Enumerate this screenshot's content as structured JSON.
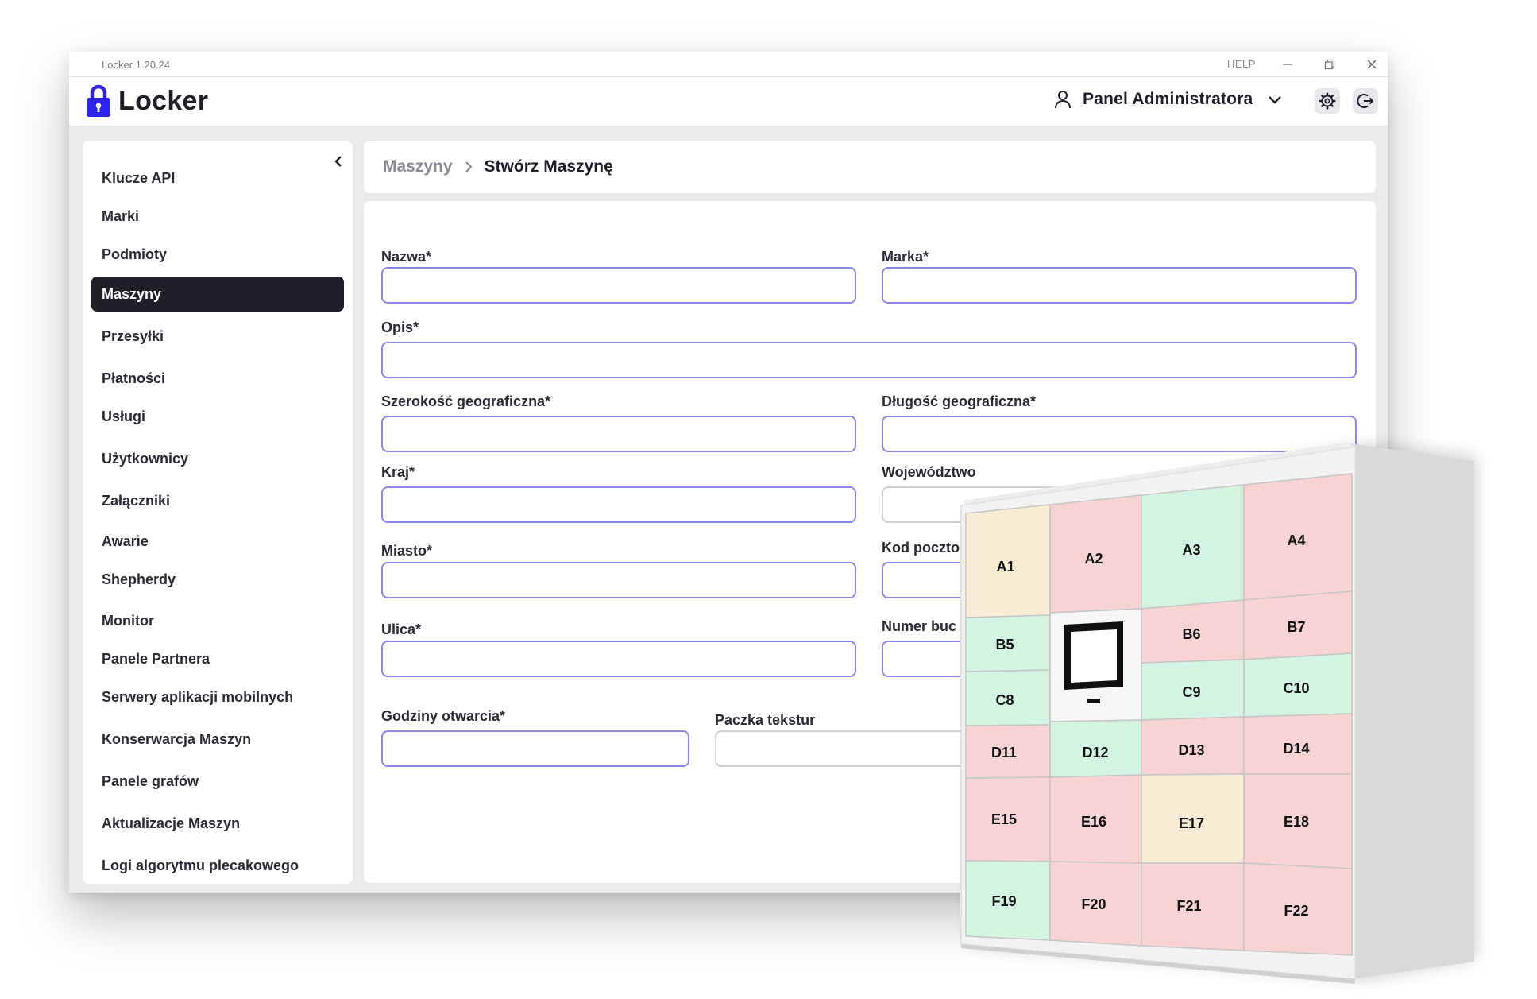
{
  "window": {
    "title": "Locker 1.20.24",
    "help": "HELP"
  },
  "app": {
    "name": "Locker",
    "user_label": "Panel Administratora"
  },
  "sidebar": {
    "items": [
      {
        "label": "Klucze API",
        "active": false
      },
      {
        "label": "Marki",
        "active": false
      },
      {
        "label": "Podmioty",
        "active": false
      },
      {
        "label": "Maszyny",
        "active": true
      },
      {
        "label": "Przesyłki",
        "active": false
      },
      {
        "label": "Płatności",
        "active": false
      },
      {
        "label": "Usługi",
        "active": false
      },
      {
        "label": "Użytkownicy",
        "active": false
      },
      {
        "label": "Załączniki",
        "active": false
      },
      {
        "label": "Awarie",
        "active": false
      },
      {
        "label": "Shepherdy",
        "active": false
      },
      {
        "label": "Monitor",
        "active": false
      },
      {
        "label": "Panele Partnera",
        "active": false
      },
      {
        "label": "Serwery aplikacji mobilnych",
        "active": false
      },
      {
        "label": "Konserwarcja Maszyn",
        "active": false
      },
      {
        "label": "Panele grafów",
        "active": false
      },
      {
        "label": "Aktualizacje Maszyn",
        "active": false
      },
      {
        "label": "Logi algorytmu plecakowego",
        "active": false
      }
    ]
  },
  "breadcrumb": {
    "parent": "Maszyny",
    "current": "Stwórz Maszynę"
  },
  "form": {
    "nazwa": {
      "label": "Nazwa*",
      "value": ""
    },
    "marka": {
      "label": "Marka*",
      "value": ""
    },
    "opis": {
      "label": "Opis*",
      "value": ""
    },
    "szerokosc": {
      "label": "Szerokość geograficzna*",
      "value": ""
    },
    "dlugosc": {
      "label": "Długość geograficzna*",
      "value": ""
    },
    "kraj": {
      "label": "Kraj*",
      "value": ""
    },
    "wojewodztwo": {
      "label": "Województwo",
      "value": ""
    },
    "miasto": {
      "label": "Miasto*",
      "value": ""
    },
    "kod_pocztowy": {
      "label": "Kod poczto",
      "value": ""
    },
    "ulica": {
      "label": "Ulica*",
      "value": ""
    },
    "numer_budynku": {
      "label": "Numer buc",
      "value": ""
    },
    "godziny": {
      "label": "Godziny otwarcia*",
      "value": ""
    },
    "paczka": {
      "label": "Paczka tekstur",
      "value": ""
    }
  },
  "locker_cells": [
    {
      "id": "A1",
      "status": "cream"
    },
    {
      "id": "A2",
      "status": "pink"
    },
    {
      "id": "A3",
      "status": "green"
    },
    {
      "id": "A4",
      "status": "pink"
    },
    {
      "id": "B5",
      "status": "green"
    },
    {
      "id": "B6",
      "status": "pink"
    },
    {
      "id": "B7",
      "status": "pink"
    },
    {
      "id": "C8",
      "status": "green"
    },
    {
      "id": "C9",
      "status": "green"
    },
    {
      "id": "C10",
      "status": "green"
    },
    {
      "id": "D11",
      "status": "pink"
    },
    {
      "id": "D12",
      "status": "green"
    },
    {
      "id": "D13",
      "status": "pink"
    },
    {
      "id": "D14",
      "status": "pink"
    },
    {
      "id": "E15",
      "status": "pink"
    },
    {
      "id": "E16",
      "status": "pink"
    },
    {
      "id": "E17",
      "status": "cream"
    },
    {
      "id": "E18",
      "status": "pink"
    },
    {
      "id": "F19",
      "status": "green"
    },
    {
      "id": "F20",
      "status": "pink"
    },
    {
      "id": "F21",
      "status": "pink"
    },
    {
      "id": "F22",
      "status": "pink"
    }
  ],
  "colors": {
    "accent": "#8b85f0",
    "active_nav": "#1f1f28",
    "logo": "#2f22ee",
    "cell_pink": "#f7d3d3",
    "cell_green": "#d3f4e1",
    "cell_cream": "#f8edd4"
  }
}
